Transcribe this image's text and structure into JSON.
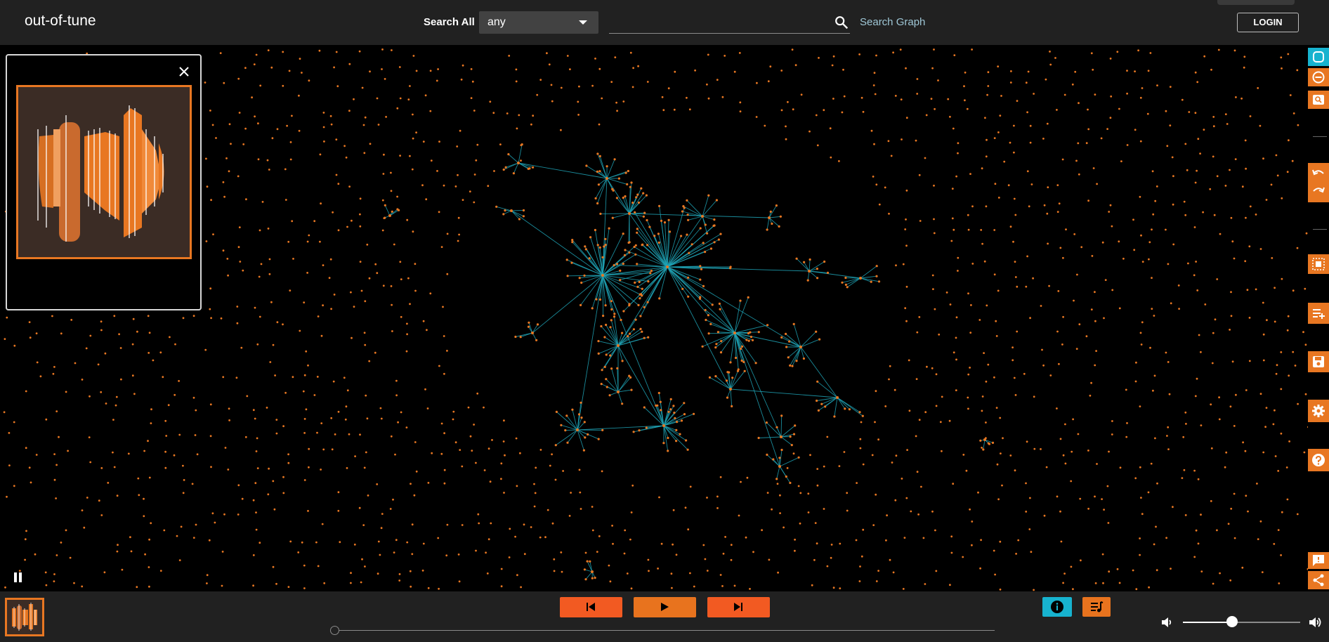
{
  "header": {
    "brand": "out-of-tune",
    "search_all_label": "Search All",
    "select_value": "any",
    "search_placeholder": "",
    "search_graph_label": "Search Graph",
    "login_label": "LOGIN"
  },
  "player": {
    "volume_level": 0.42,
    "progress": 0.0
  },
  "colors": {
    "accent": "#e87722",
    "next_prev": "#f25a22",
    "info": "#17b3cf",
    "edge": "#1fa3b5",
    "node": "#e87722",
    "header_bg": "#212121"
  },
  "toolbar_icons": [
    "fit-icon",
    "zoom-out-icon",
    "zoom-search-icon",
    "undo-icon",
    "redo-icon",
    "select-region-icon",
    "playlist-add-icon",
    "save-icon",
    "settings-icon",
    "help-icon",
    "feedback-icon",
    "share-icon"
  ]
}
